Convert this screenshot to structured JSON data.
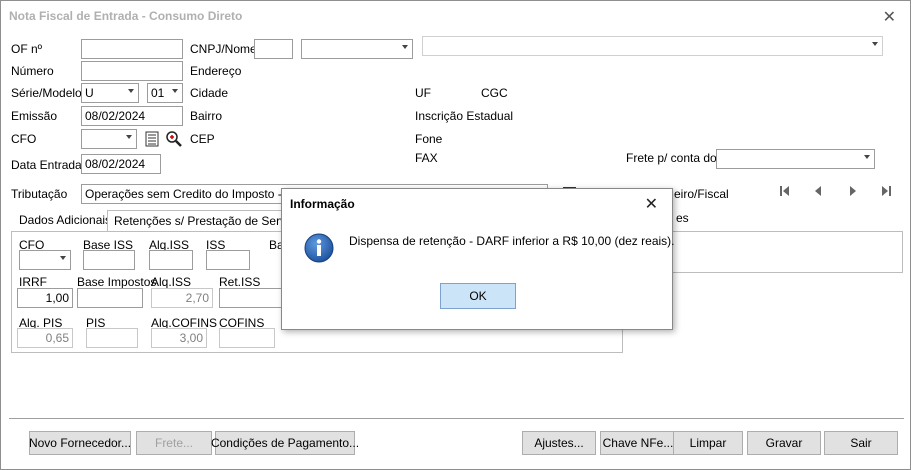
{
  "window": {
    "title": "Nota Fiscal de Entrada - Consumo Direto",
    "close_glyph": "✕"
  },
  "header": {
    "of_label": "OF nº",
    "numero_label": "Número",
    "serie_label": "Série/Modelo",
    "serie_value": "U",
    "modelo_value": "01",
    "emissao_label": "Emissão",
    "emissao_value": "08/02/2024",
    "cfo_label": "CFO",
    "data_entrada_label": "Data Entrada",
    "data_entrada_value": "08/02/2024",
    "cnpj_label": "CNPJ/Nome",
    "endereco_label": "Endereço",
    "cidade_label": "Cidade",
    "bairro_label": "Bairro",
    "cep_label": "CEP",
    "uf_label": "UF",
    "cgc_label": "CGC",
    "ie_label": "Inscrição Estadual",
    "fone_label": "Fone",
    "fax_label": "FAX",
    "frete_label": "Frete p/ conta do",
    "tributacao_label": "Tributação",
    "tributacao_value": "Operações sem Credito do Imposto - Outras",
    "checkbox_label": "eiro/Fiscal"
  },
  "tabs": {
    "tab1": "Dados Adicionais",
    "tab2": "Retenções s/ Prestação de Serviços",
    "tab3_partial": "es"
  },
  "retencoes": {
    "cfo": "CFO",
    "base_iss": "Base ISS",
    "alq_iss": "Alq.ISS",
    "iss": "ISS",
    "ba": "Ba",
    "irrf": "IRRF",
    "irrf_value": "1,00",
    "base_impostos": "Base Impostos",
    "alq_iss2": "Alq.ISS",
    "alq_iss2_value": "2,70",
    "ret_iss": "Ret.ISS",
    "alq_pis": "Alq. PIS",
    "alq_pis_value": "0,65",
    "pis": "PIS",
    "alq_cofins": "Alq.COFINS",
    "alq_cofins_value": "3,00",
    "cofins": "COFINS"
  },
  "footer": {
    "novo_fornecedor": "Novo Fornecedor...",
    "frete": "Frete...",
    "condicoes": "Condições de Pagamento...",
    "ajustes": "Ajustes...",
    "chave_nfe": "Chave NFe...",
    "limpar": "Limpar",
    "gravar": "Gravar",
    "sair": "Sair"
  },
  "dialog": {
    "title": "Informação",
    "message": "Dispensa de retenção - DARF inferior a R$ 10,00 (dez reais).",
    "ok": "OK",
    "icon": "information-icon",
    "close_glyph": "✕"
  },
  "colors": {
    "ok_button_bg": "#cce4f7",
    "ok_button_border": "#7da2ce",
    "info_icon": "#1c5aa8"
  }
}
